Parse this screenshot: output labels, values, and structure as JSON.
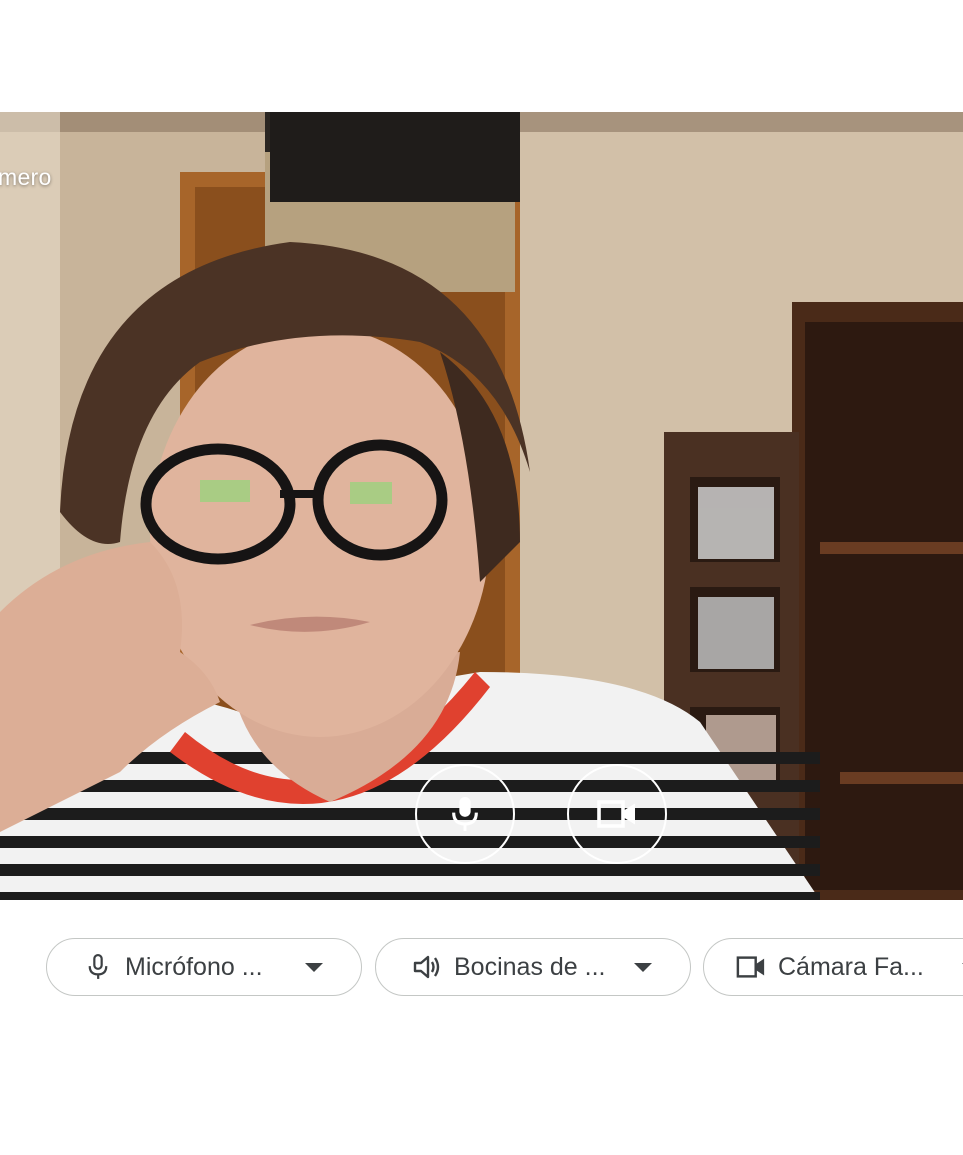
{
  "preview": {
    "participant_name": "mero",
    "mic_button_icon": "microphone-icon",
    "camera_button_icon": "video-camera-icon"
  },
  "devices": {
    "microphone": {
      "icon": "microphone-icon",
      "label": "Micrófono ..."
    },
    "speakers": {
      "icon": "speaker-icon",
      "label": "Bocinas de ..."
    },
    "camera": {
      "icon": "video-camera-icon",
      "label": "Cámara Fa..."
    }
  },
  "colors": {
    "pill_border": "#c4c7c5",
    "pill_text": "#3c4043",
    "overlay_icon": "#ffffff"
  }
}
